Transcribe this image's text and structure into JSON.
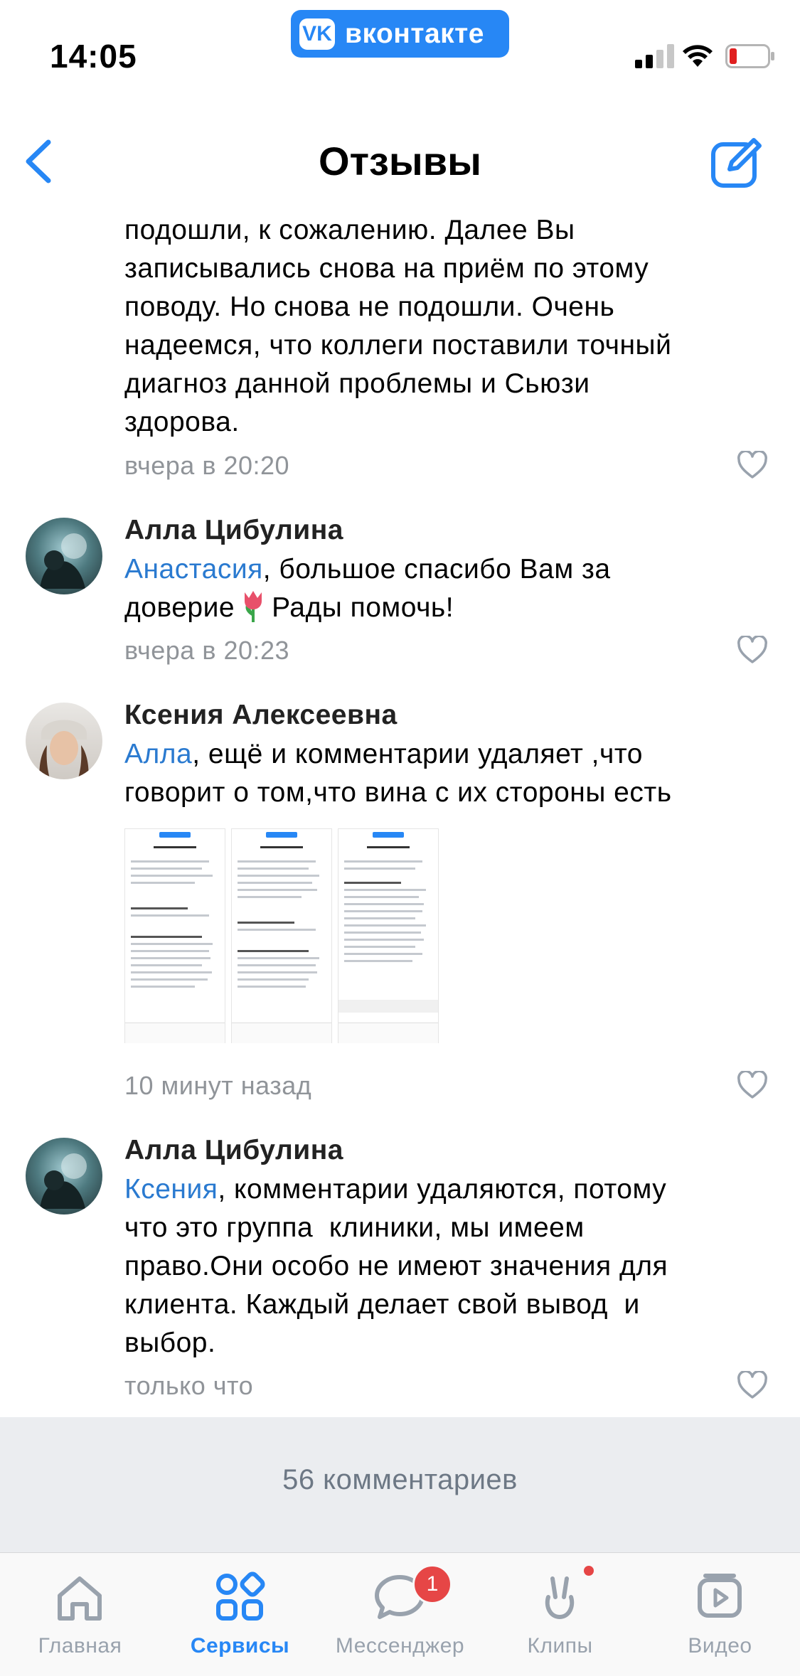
{
  "status_bar": {
    "time": "14:05",
    "app_badge": "вконтакте"
  },
  "nav": {
    "title": "Отзывы"
  },
  "comments": [
    {
      "text": "подошли, к сожалению. Далее Вы записывались снова на приём по этому поводу. Но снова не подошли. Очень надеемся, что коллеги поставили точный диагноз данной проблемы и Сьюзи здорова.",
      "lines": [
        "подошли, к сожалению. Далее Вы",
        "записывались снова на приём по этому",
        "поводу. Но снова не подошли. Очень",
        "надеемся, что коллеги поставили точный",
        "диагноз данной проблемы и Сьюзи",
        "здорова."
      ],
      "time": "вчера в 20:20"
    },
    {
      "author": "Алла Цибулина",
      "mention": "Анастасия",
      "line1_rest": ", большое спасибо Вам за",
      "line2_a": "доверие",
      "line2_b": "Рады помочь!",
      "time": "вчера в 20:23"
    },
    {
      "author": "Ксения Алексеевна",
      "mention": "Алла",
      "line1_rest": ", ещё и комментарии удаляет ,что",
      "line2": "говорит о том,что вина с их стороны есть",
      "time": "10 минут назад"
    },
    {
      "author": "Алла Цибулина",
      "mention": "Ксения",
      "line1_rest": ", комментарии удаляются, потому",
      "lines": [
        "что это группа  клиники, мы имеем",
        "право.Они особо не имеют значения для",
        "клиента. Каждый делает свой вывод  и",
        "выбор."
      ],
      "time": "только что"
    }
  ],
  "comments_count": "56 комментариев",
  "tabbar": [
    {
      "label": "Главная",
      "icon": "home-icon"
    },
    {
      "label": "Сервисы",
      "icon": "services-icon",
      "active": true
    },
    {
      "label": "Мессенджер",
      "icon": "messenger-icon",
      "badge": "1"
    },
    {
      "label": "Клипы",
      "icon": "clips-icon"
    },
    {
      "label": "Видео",
      "icon": "video-icon"
    }
  ],
  "colors": {
    "accent": "#2787f5",
    "mention": "#2a7ad0",
    "meta": "#909499",
    "badge": "#e64646"
  }
}
